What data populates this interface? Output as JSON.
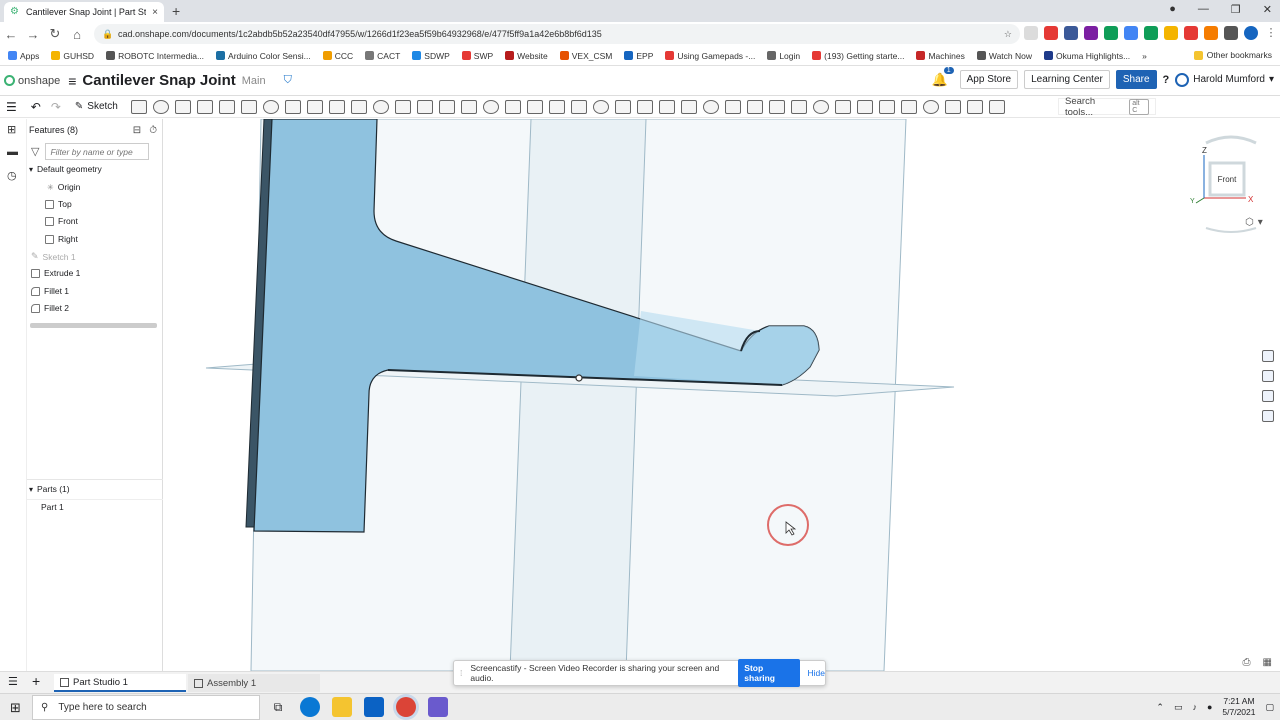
{
  "browser": {
    "tab_title": "Cantilever Snap Joint | Part Studio",
    "url": "cad.onshape.com/documents/1c2abdb5b52a23540df47955/w/1266d1f23ea5f59b64932968/e/477f5ff9a1a42e6b8bf6d135",
    "new_tab": "+",
    "close": "×",
    "bookmarks": [
      {
        "label": "Apps",
        "color": "#4285f4"
      },
      {
        "label": "GUHSD",
        "color": "#f4b400"
      },
      {
        "label": "ROBOTC Intermedia...",
        "color": "#555555"
      },
      {
        "label": "Arduino Color Sensi...",
        "color": "#1c6fa4"
      },
      {
        "label": "CCC",
        "color": "#f09d00"
      },
      {
        "label": "CACT",
        "color": "#777777"
      },
      {
        "label": "SDWP",
        "color": "#1e88e5"
      },
      {
        "label": "SWP",
        "color": "#e53935"
      },
      {
        "label": "Website",
        "color": "#b71c1c"
      },
      {
        "label": "VEX_CSM",
        "color": "#e65100"
      },
      {
        "label": "EPP",
        "color": "#1565c0"
      },
      {
        "label": "Using Gamepads -...",
        "color": "#e53935"
      },
      {
        "label": "Login",
        "color": "#666666"
      },
      {
        "label": "(193) Getting starte...",
        "color": "#e53935"
      },
      {
        "label": "Machines",
        "color": "#c62828"
      },
      {
        "label": "Watch Now",
        "color": "#555555"
      },
      {
        "label": "Okuma Highlights...",
        "color": "#1e3a8a"
      }
    ],
    "bookmarks_more": "»",
    "other_bookmarks": "Other bookmarks"
  },
  "onshape": {
    "logo_text": "onshape",
    "document_name": "Cantilever Snap Joint",
    "branch": "Main",
    "notifications_count": "1",
    "app_store": "App Store",
    "learning_center": "Learning Center",
    "share": "Share",
    "help": "?",
    "user_name": "Harold Mumford"
  },
  "toolbar": {
    "sketch_label": "Sketch",
    "search_placeholder": "Search tools...",
    "search_shortcut": "alt C"
  },
  "features": {
    "header": "Features (8)",
    "filter_placeholder": "Filter by name or type",
    "default_geometry": "Default geometry",
    "items": [
      "Origin",
      "Top",
      "Front",
      "Right",
      "Sketch 1",
      "Extrude 1",
      "Fillet 1",
      "Fillet 2"
    ],
    "parts_header": "Parts (1)",
    "parts": [
      "Part 1"
    ]
  },
  "viewcube": {
    "face": "Front",
    "axis_z": "Z",
    "axis_x": "X",
    "axis_y": "Y"
  },
  "tabs": {
    "part_studio": "Part Studio 1",
    "assembly": "Assembly 1"
  },
  "screencastify": {
    "message": "Screencastify - Screen Video Recorder is sharing your screen and audio.",
    "stop": "Stop sharing",
    "hide": "Hide"
  },
  "taskbar": {
    "search_placeholder": "Type here to search",
    "time": "7:21 AM",
    "date": "5/7/2021"
  },
  "colors": {
    "part_fill": "#8fc2df",
    "part_fill_light": "#b6dcf0",
    "part_edge": "#2c3e4a",
    "plane": "#e8f0f4",
    "accent": "#1e63b4",
    "cursor_ring": "#d9534f"
  }
}
